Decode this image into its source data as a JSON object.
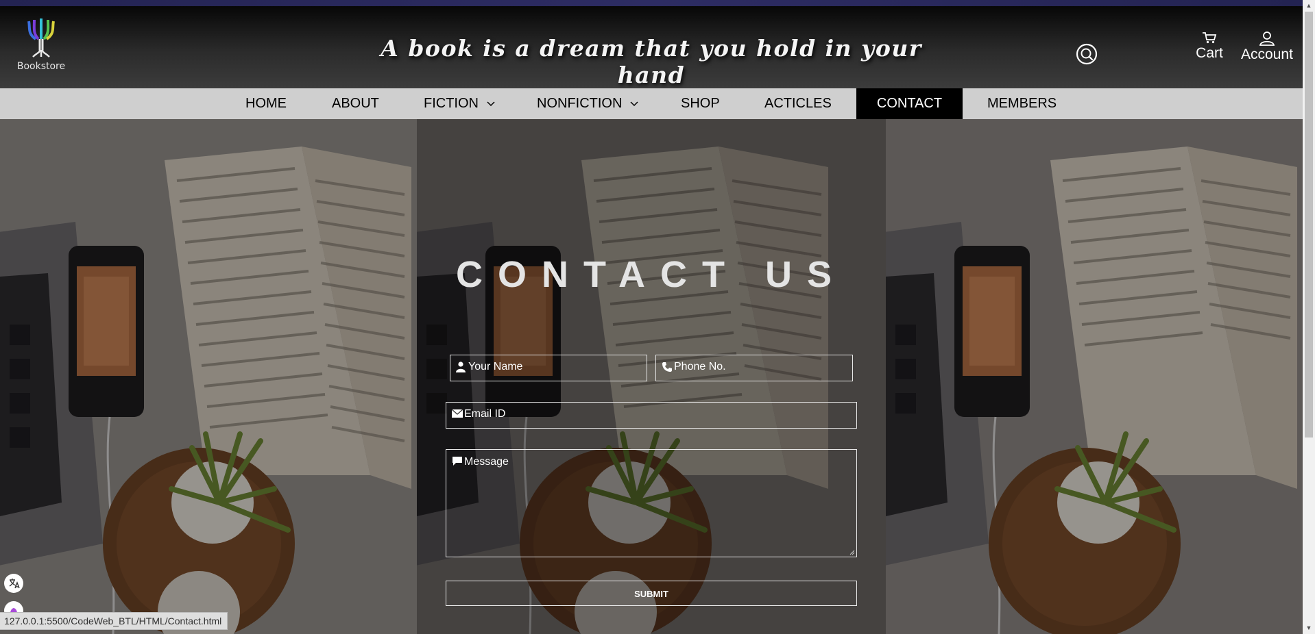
{
  "header": {
    "logo_text": "Bookstore",
    "tagline": "A book is a dream that you hold in your hand",
    "cart_label": "Cart",
    "account_label": "Account"
  },
  "nav": {
    "items": [
      {
        "label": "HOME"
      },
      {
        "label": "ABOUT"
      },
      {
        "label": "FICTION",
        "has_dropdown": true
      },
      {
        "label": "NONFICTION",
        "has_dropdown": true
      },
      {
        "label": "SHOP"
      },
      {
        "label": "ACTICLES"
      },
      {
        "label": "CONTACT",
        "active": true
      },
      {
        "label": "MEMBERS"
      }
    ]
  },
  "contact": {
    "title": "CONTACT US",
    "name_placeholder": "Your Name",
    "phone_placeholder": "Phone No.",
    "email_placeholder": "Email ID",
    "message_placeholder": "Message",
    "submit_label": "SUBMIT"
  },
  "status_bar": {
    "url": "127.0.0.1:5500/CodeWeb_BTL/HTML/Contact.html"
  },
  "colors": {
    "nav_bg": "#cfcfcf",
    "nav_active_bg": "#000000",
    "header_bg": "#1a1a1a",
    "text_light": "#ffffff"
  }
}
